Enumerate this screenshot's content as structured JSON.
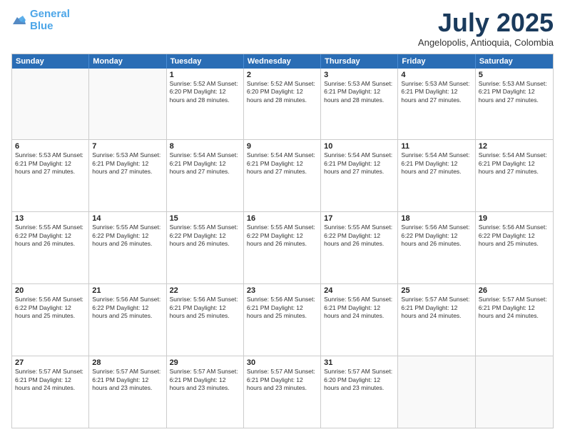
{
  "logo": {
    "line1": "General",
    "line2": "Blue"
  },
  "title": "July 2025",
  "subtitle": "Angelopolis, Antioquia, Colombia",
  "header_days": [
    "Sunday",
    "Monday",
    "Tuesday",
    "Wednesday",
    "Thursday",
    "Friday",
    "Saturday"
  ],
  "weeks": [
    [
      {
        "day": "",
        "text": ""
      },
      {
        "day": "",
        "text": ""
      },
      {
        "day": "1",
        "text": "Sunrise: 5:52 AM\nSunset: 6:20 PM\nDaylight: 12 hours\nand 28 minutes."
      },
      {
        "day": "2",
        "text": "Sunrise: 5:52 AM\nSunset: 6:20 PM\nDaylight: 12 hours\nand 28 minutes."
      },
      {
        "day": "3",
        "text": "Sunrise: 5:53 AM\nSunset: 6:21 PM\nDaylight: 12 hours\nand 28 minutes."
      },
      {
        "day": "4",
        "text": "Sunrise: 5:53 AM\nSunset: 6:21 PM\nDaylight: 12 hours\nand 27 minutes."
      },
      {
        "day": "5",
        "text": "Sunrise: 5:53 AM\nSunset: 6:21 PM\nDaylight: 12 hours\nand 27 minutes."
      }
    ],
    [
      {
        "day": "6",
        "text": "Sunrise: 5:53 AM\nSunset: 6:21 PM\nDaylight: 12 hours\nand 27 minutes."
      },
      {
        "day": "7",
        "text": "Sunrise: 5:53 AM\nSunset: 6:21 PM\nDaylight: 12 hours\nand 27 minutes."
      },
      {
        "day": "8",
        "text": "Sunrise: 5:54 AM\nSunset: 6:21 PM\nDaylight: 12 hours\nand 27 minutes."
      },
      {
        "day": "9",
        "text": "Sunrise: 5:54 AM\nSunset: 6:21 PM\nDaylight: 12 hours\nand 27 minutes."
      },
      {
        "day": "10",
        "text": "Sunrise: 5:54 AM\nSunset: 6:21 PM\nDaylight: 12 hours\nand 27 minutes."
      },
      {
        "day": "11",
        "text": "Sunrise: 5:54 AM\nSunset: 6:21 PM\nDaylight: 12 hours\nand 27 minutes."
      },
      {
        "day": "12",
        "text": "Sunrise: 5:54 AM\nSunset: 6:21 PM\nDaylight: 12 hours\nand 27 minutes."
      }
    ],
    [
      {
        "day": "13",
        "text": "Sunrise: 5:55 AM\nSunset: 6:22 PM\nDaylight: 12 hours\nand 26 minutes."
      },
      {
        "day": "14",
        "text": "Sunrise: 5:55 AM\nSunset: 6:22 PM\nDaylight: 12 hours\nand 26 minutes."
      },
      {
        "day": "15",
        "text": "Sunrise: 5:55 AM\nSunset: 6:22 PM\nDaylight: 12 hours\nand 26 minutes."
      },
      {
        "day": "16",
        "text": "Sunrise: 5:55 AM\nSunset: 6:22 PM\nDaylight: 12 hours\nand 26 minutes."
      },
      {
        "day": "17",
        "text": "Sunrise: 5:55 AM\nSunset: 6:22 PM\nDaylight: 12 hours\nand 26 minutes."
      },
      {
        "day": "18",
        "text": "Sunrise: 5:56 AM\nSunset: 6:22 PM\nDaylight: 12 hours\nand 26 minutes."
      },
      {
        "day": "19",
        "text": "Sunrise: 5:56 AM\nSunset: 6:22 PM\nDaylight: 12 hours\nand 25 minutes."
      }
    ],
    [
      {
        "day": "20",
        "text": "Sunrise: 5:56 AM\nSunset: 6:22 PM\nDaylight: 12 hours\nand 25 minutes."
      },
      {
        "day": "21",
        "text": "Sunrise: 5:56 AM\nSunset: 6:22 PM\nDaylight: 12 hours\nand 25 minutes."
      },
      {
        "day": "22",
        "text": "Sunrise: 5:56 AM\nSunset: 6:21 PM\nDaylight: 12 hours\nand 25 minutes."
      },
      {
        "day": "23",
        "text": "Sunrise: 5:56 AM\nSunset: 6:21 PM\nDaylight: 12 hours\nand 25 minutes."
      },
      {
        "day": "24",
        "text": "Sunrise: 5:56 AM\nSunset: 6:21 PM\nDaylight: 12 hours\nand 24 minutes."
      },
      {
        "day": "25",
        "text": "Sunrise: 5:57 AM\nSunset: 6:21 PM\nDaylight: 12 hours\nand 24 minutes."
      },
      {
        "day": "26",
        "text": "Sunrise: 5:57 AM\nSunset: 6:21 PM\nDaylight: 12 hours\nand 24 minutes."
      }
    ],
    [
      {
        "day": "27",
        "text": "Sunrise: 5:57 AM\nSunset: 6:21 PM\nDaylight: 12 hours\nand 24 minutes."
      },
      {
        "day": "28",
        "text": "Sunrise: 5:57 AM\nSunset: 6:21 PM\nDaylight: 12 hours\nand 23 minutes."
      },
      {
        "day": "29",
        "text": "Sunrise: 5:57 AM\nSunset: 6:21 PM\nDaylight: 12 hours\nand 23 minutes."
      },
      {
        "day": "30",
        "text": "Sunrise: 5:57 AM\nSunset: 6:21 PM\nDaylight: 12 hours\nand 23 minutes."
      },
      {
        "day": "31",
        "text": "Sunrise: 5:57 AM\nSunset: 6:20 PM\nDaylight: 12 hours\nand 23 minutes."
      },
      {
        "day": "",
        "text": ""
      },
      {
        "day": "",
        "text": ""
      }
    ]
  ]
}
